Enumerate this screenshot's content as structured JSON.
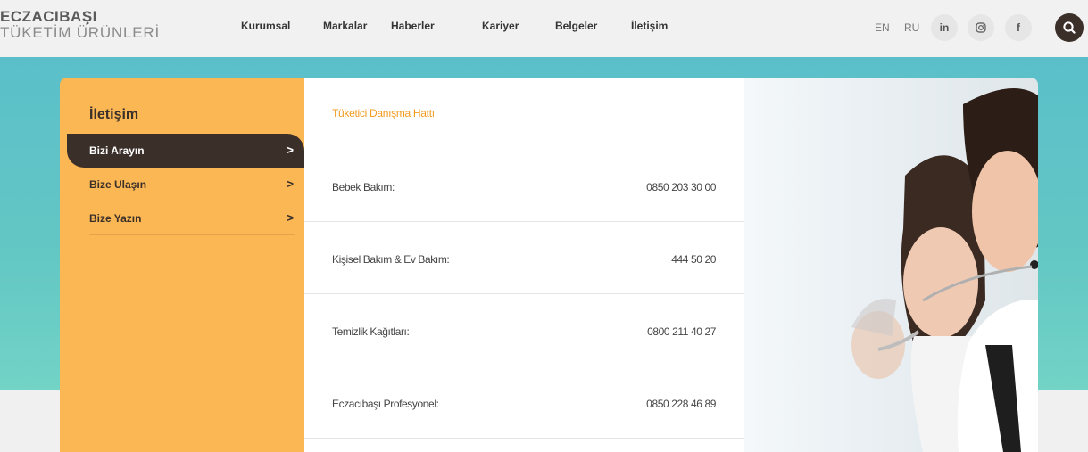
{
  "brand": {
    "line1": "ECZACIBAŞI",
    "line2": "TÜKETİM ÜRÜNLERİ"
  },
  "nav": {
    "items": [
      {
        "label": "Kurumsal"
      },
      {
        "label": "Markalar"
      },
      {
        "label": "Haberler"
      },
      {
        "label": "Kariyer"
      },
      {
        "label": "Belgeler"
      },
      {
        "label": "İletişim"
      }
    ]
  },
  "languages": {
    "en": "EN",
    "ru": "RU"
  },
  "social": {
    "linkedin": "in",
    "instagram": "instagram-icon",
    "facebook": "f"
  },
  "search": {
    "icon": "search-icon"
  },
  "sidebar": {
    "title": "İletişim",
    "items": [
      {
        "label": "Bizi Arayın",
        "arrow": ">",
        "active": true
      },
      {
        "label": "Bize Ulaşın",
        "arrow": ">"
      },
      {
        "label": "Bize Yazın",
        "arrow": ">"
      }
    ]
  },
  "content": {
    "title": "Tüketici Danışma Hattı",
    "rows": [
      {
        "label": "Bebek Bakım:",
        "phone": "0850 203 30 00"
      },
      {
        "label": "Kişisel Bakım & Ev Bakım:",
        "phone": "444 50 20"
      },
      {
        "label": "Temizlik Kağıtları:",
        "phone": "0800 211 40 27"
      },
      {
        "label": "Eczacıbaşı Profesyonel:",
        "phone": "0850 228 46 89"
      }
    ]
  },
  "colors": {
    "accent": "#fbb753",
    "dark": "#3b2f2a",
    "teal": "#5bbfca",
    "title_orange": "#f39a1e"
  }
}
